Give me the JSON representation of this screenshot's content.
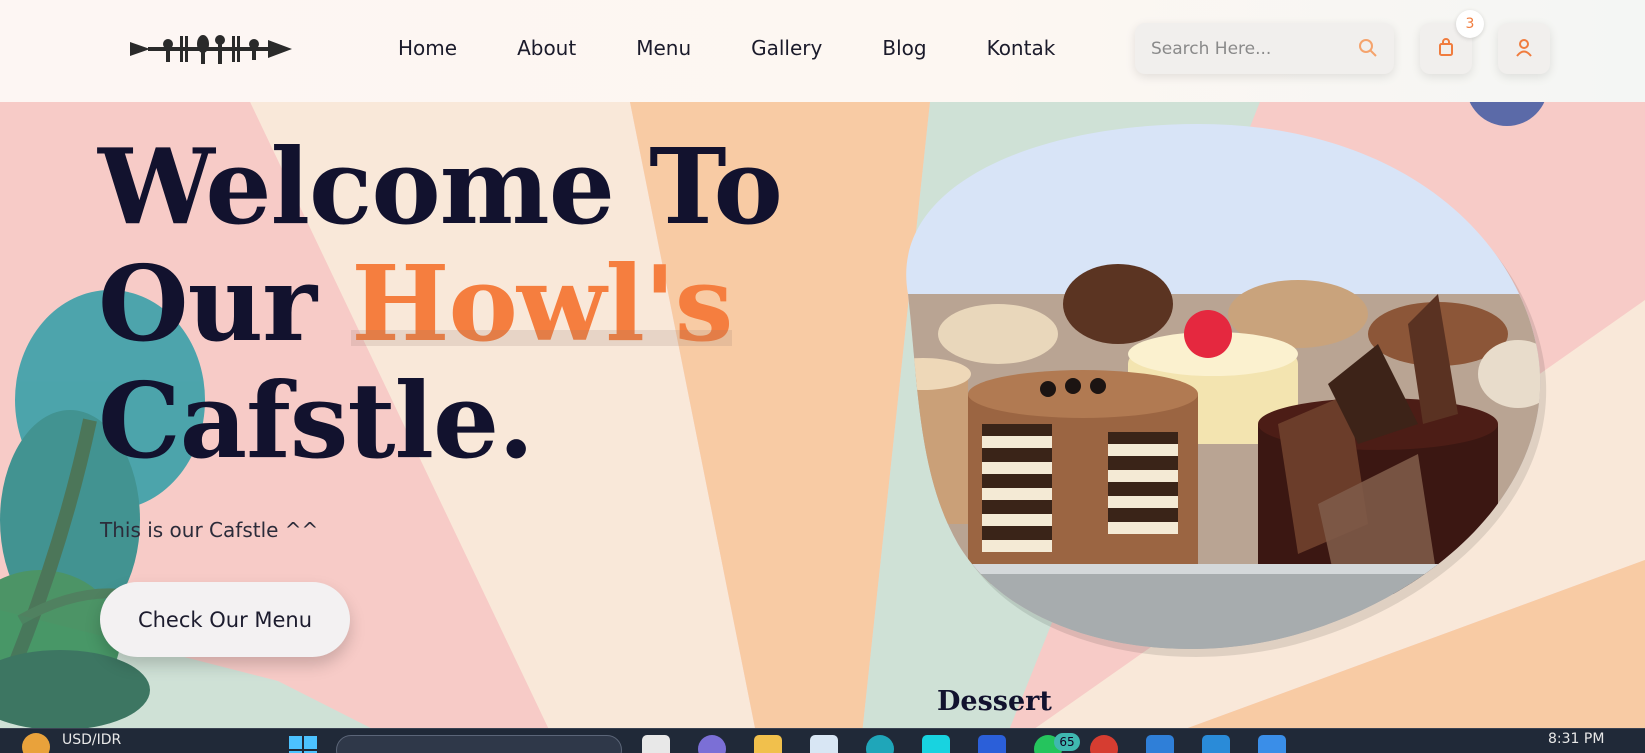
{
  "brand": {
    "logo_icon": "cutlery-fish-logo"
  },
  "nav": {
    "items": [
      {
        "label": "Home"
      },
      {
        "label": "About"
      },
      {
        "label": "Menu"
      },
      {
        "label": "Gallery"
      },
      {
        "label": "Blog"
      },
      {
        "label": "Kontak"
      }
    ]
  },
  "search": {
    "placeholder": "Search Here...",
    "icon": "search-icon"
  },
  "cart": {
    "icon": "shopping-bag-icon",
    "badge": "3"
  },
  "user": {
    "icon": "user-icon"
  },
  "hero": {
    "line1": "Welcome To",
    "line2_prefix": "Our ",
    "line2_accent": "Howl's",
    "line3": "Cafstle.",
    "tagline": "This is our Cafstle ^^",
    "cta_label": "Check Our Menu",
    "image_alt_icon": "dessert-cakes-image",
    "caption": "Dessert"
  },
  "taskbar": {
    "ticker": "USD/IDR",
    "notification_count": "65",
    "clock": "8:31 PM"
  },
  "colors": {
    "accent": "#f57e3f",
    "heading": "#12122e",
    "pink": "#f7cbc7",
    "cream": "#f9e8d9",
    "peach": "#f7c9a3",
    "mint": "#cde0d4",
    "taskbar": "#202938"
  }
}
